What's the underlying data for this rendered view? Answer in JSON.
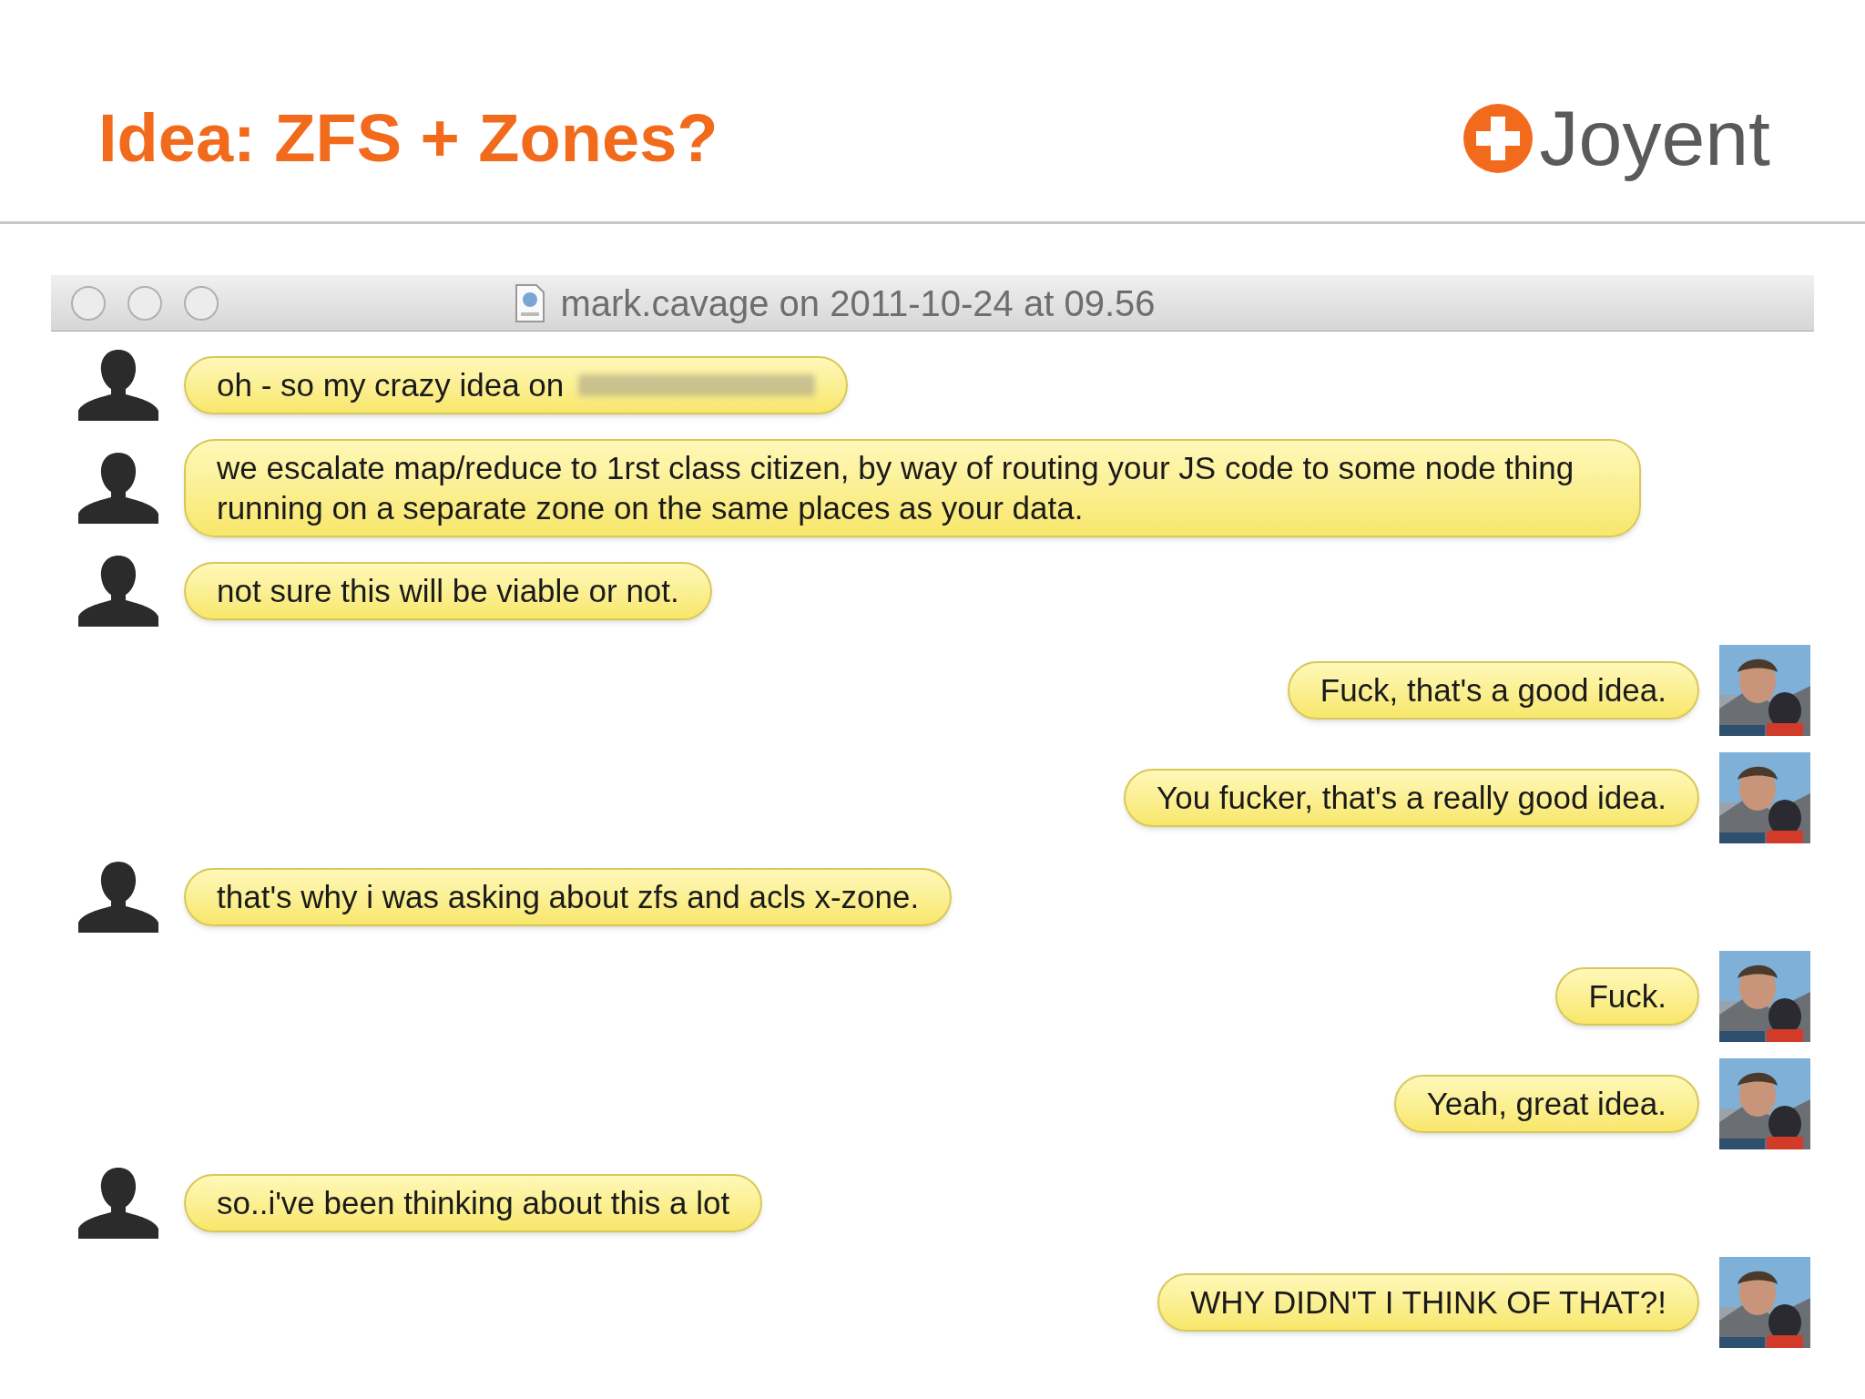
{
  "slide": {
    "title": "Idea: ZFS + Zones?",
    "logo_text": "Joyent"
  },
  "window": {
    "title": "mark.cavage on 2011-10-24 at 09.56"
  },
  "messages": [
    {
      "kind": "incoming",
      "text": "oh - so my crazy idea on",
      "redacted": true
    },
    {
      "kind": "incoming",
      "text": "we escalate map/reduce to 1rst class citizen, by way of routing your JS code to some node thing running on a separate zone on the same places as your data."
    },
    {
      "kind": "incoming",
      "text": "not sure this will be viable or not."
    },
    {
      "kind": "outgoing",
      "text": "Fuck, that's a good idea."
    },
    {
      "kind": "outgoing",
      "text": "You fucker, that's a really good idea."
    },
    {
      "kind": "incoming",
      "text": "that's why i was asking about zfs and acls x-zone."
    },
    {
      "kind": "outgoing",
      "text": "Fuck."
    },
    {
      "kind": "outgoing",
      "text": "Yeah, great idea."
    },
    {
      "kind": "incoming",
      "text": "so..i've been thinking about this a lot"
    },
    {
      "kind": "outgoing",
      "text": "WHY DIDN'T I THINK OF THAT?!"
    }
  ]
}
